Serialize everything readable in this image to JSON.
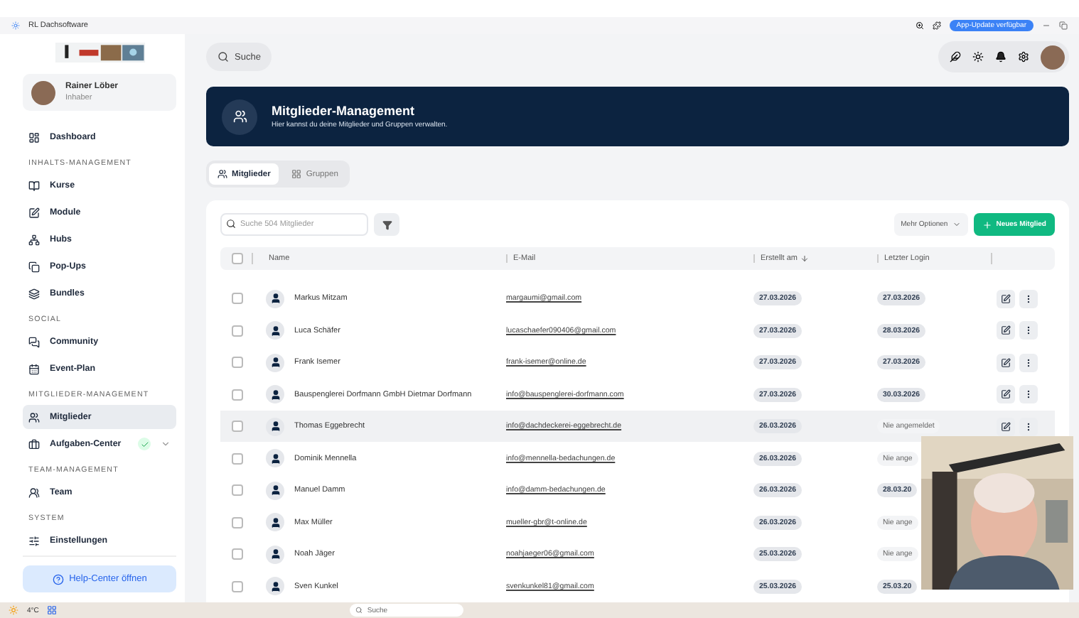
{
  "titlebar": {
    "app_name": "RL Dachsoftware",
    "update_badge": "App-Update verfügbar"
  },
  "sidebar": {
    "user": {
      "name": "Rainer Löber",
      "role": "Inhaber"
    },
    "sections": [
      {
        "items": [
          {
            "label": "Dashboard",
            "selected": false
          }
        ]
      },
      {
        "title": "INHALTS-MANAGEMENT",
        "items": [
          {
            "label": "Kurse",
            "selected": false
          },
          {
            "label": "Module",
            "selected": false
          },
          {
            "label": "Hubs",
            "selected": false
          },
          {
            "label": "Pop-Ups",
            "selected": false
          },
          {
            "label": "Bundles",
            "selected": false
          }
        ]
      },
      {
        "title": "SOCIAL",
        "items": [
          {
            "label": "Community",
            "selected": false
          },
          {
            "label": "Event-Plan",
            "selected": false
          }
        ]
      },
      {
        "title": "MITGLIEDER-MANAGEMENT",
        "items": [
          {
            "label": "Mitglieder",
            "selected": true
          },
          {
            "label": "Aufgaben-Center",
            "selected": false,
            "done": true,
            "expandable": true
          }
        ]
      },
      {
        "title": "TEAM-MANAGEMENT",
        "items": [
          {
            "label": "Team",
            "selected": false
          }
        ]
      },
      {
        "title": "SYSTEM",
        "items": [
          {
            "label": "Einstellungen",
            "selected": false
          }
        ]
      }
    ],
    "help_button": "Help-Center öffnen"
  },
  "search": {
    "placeholder": "Suche"
  },
  "banner": {
    "title": "Mitglieder-Management",
    "subtitle": "Hier kannst du deine Mitglieder und Gruppen verwalten."
  },
  "tabs": [
    {
      "label": "Mitglieder",
      "selected": true
    },
    {
      "label": "Gruppen",
      "selected": false
    }
  ],
  "toolbar": {
    "search_placeholder": "Suche 504 Mitglieder",
    "more_options": "Mehr Optionen",
    "new_member": "Neues Mitglied"
  },
  "table": {
    "columns": [
      "Name",
      "E-Mail",
      "Erstellt am",
      "Letzter Login"
    ],
    "select_all_checked": false,
    "rows": [
      {
        "name": "Markus Mitzam",
        "email": "margaumi@gmail.com",
        "created": "27.03.2026",
        "last_login": "27.03.2026",
        "highlighted": false,
        "actions": true
      },
      {
        "name": "Luca Schäfer",
        "email": "lucaschaefer090406@gmail.com",
        "created": "27.03.2026",
        "last_login": "28.03.2026",
        "highlighted": false,
        "actions": true
      },
      {
        "name": "Frank Isemer",
        "email": "frank-isemer@online.de",
        "created": "27.03.2026",
        "last_login": "27.03.2026",
        "highlighted": false,
        "actions": true
      },
      {
        "name": "Bauspenglerei Dorfmann GmbH Dietmar Dorfmann",
        "email": "info@bauspenglerei-dorfmann.com",
        "created": "27.03.2026",
        "last_login": "30.03.2026",
        "highlighted": false,
        "actions": true
      },
      {
        "name": "Thomas Eggebrecht",
        "email": "info@dachdeckerei-eggebrecht.de",
        "created": "26.03.2026",
        "last_login": "Nie angemeldet",
        "highlighted": true,
        "actions": true
      },
      {
        "name": "Dominik Mennella",
        "email": "info@mennella-bedachungen.de",
        "created": "26.03.2026",
        "last_login": "Nie ange",
        "highlighted": false,
        "actions": false
      },
      {
        "name": "Manuel Damm",
        "email": "info@damm-bedachungen.de",
        "created": "26.03.2026",
        "last_login": "28.03.20",
        "highlighted": false,
        "actions": false
      },
      {
        "name": "Max Müller",
        "email": "mueller-gbr@t-online.de",
        "created": "26.03.2026",
        "last_login": "Nie ange",
        "highlighted": false,
        "actions": false
      },
      {
        "name": "Noah Jäger",
        "email": "noahjaeger06@gmail.com",
        "created": "25.03.2026",
        "last_login": "Nie ange",
        "highlighted": false,
        "actions": false
      },
      {
        "name": "Sven Kunkel",
        "email": "svenkunkel81@gmail.com",
        "created": "25.03.2026",
        "last_login": "25.03.20",
        "highlighted": false,
        "actions": false
      }
    ]
  },
  "taskbar": {
    "weather": "4°C",
    "search": "Suche"
  }
}
